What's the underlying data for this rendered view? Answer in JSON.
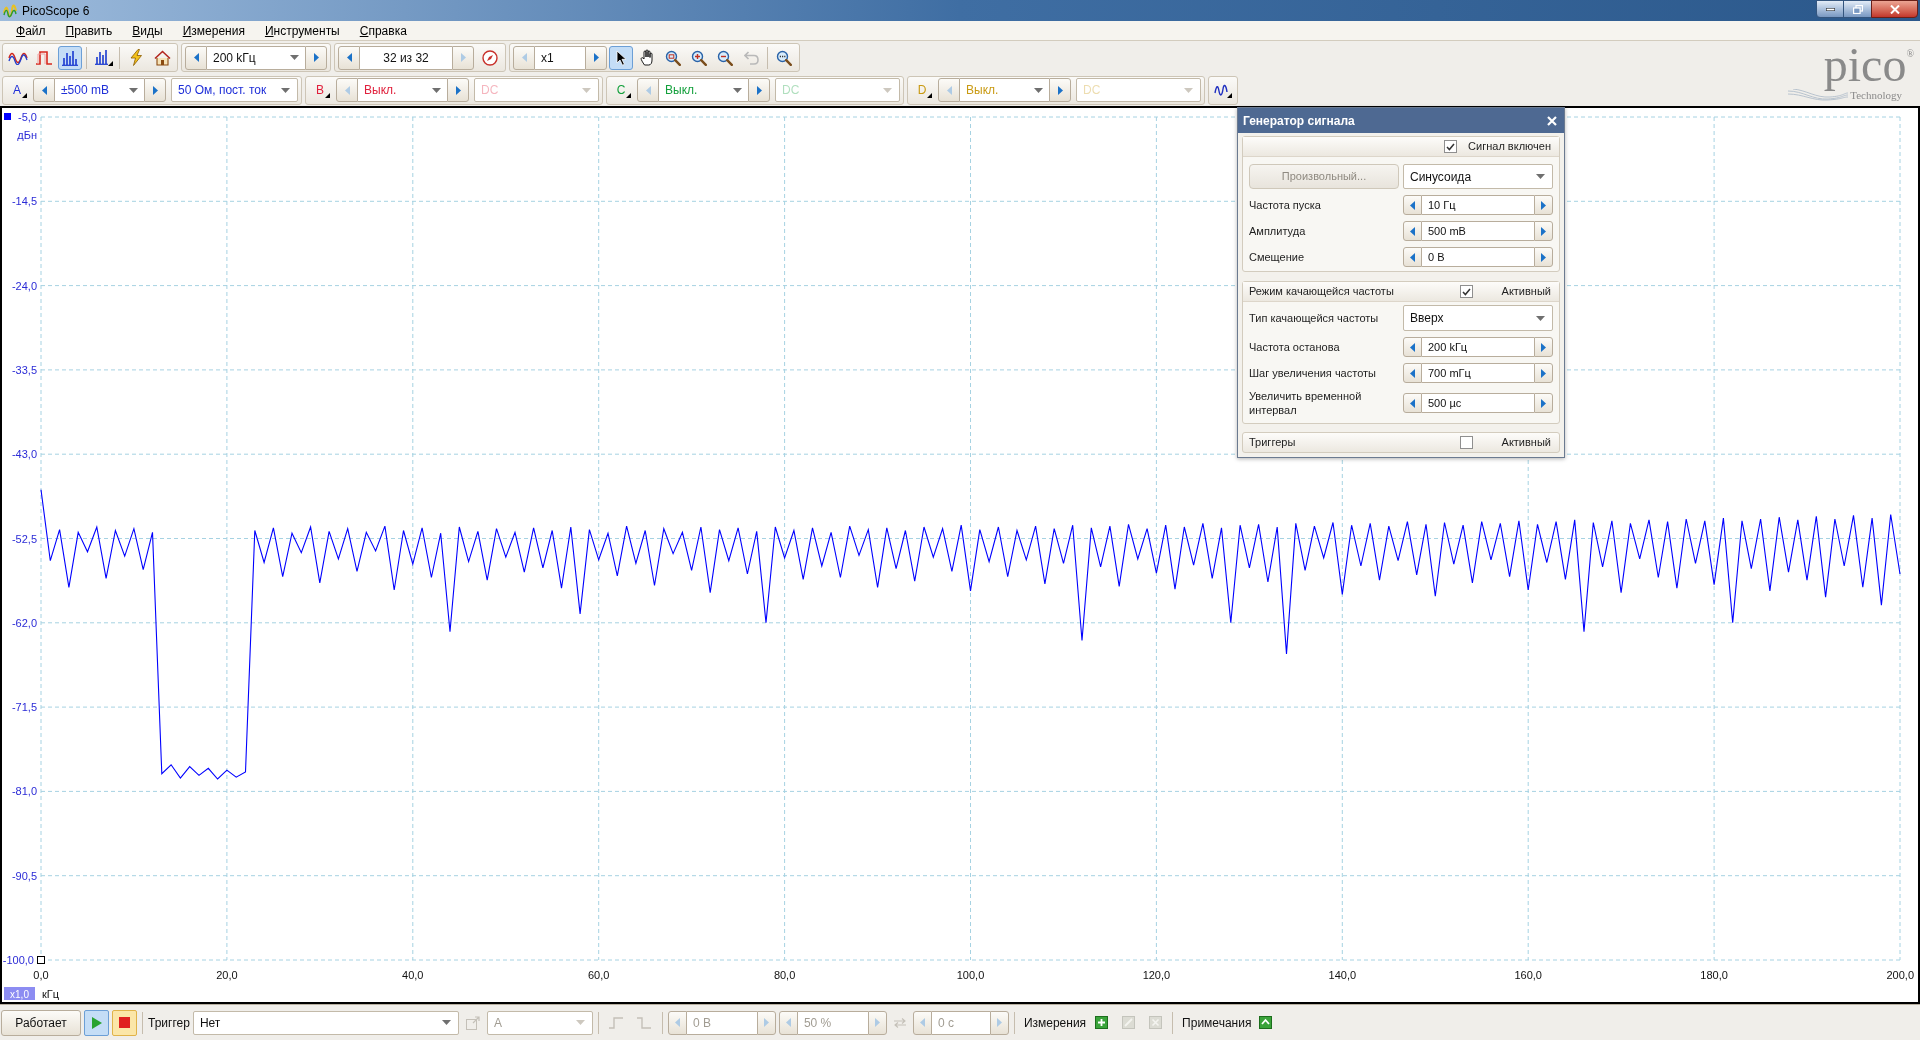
{
  "window": {
    "title": "PicoScope 6"
  },
  "menu": [
    "Файл",
    "Править",
    "Виды",
    "Измерения",
    "Инструменты",
    "Справка"
  ],
  "toolbar": {
    "modes": [
      {
        "kind": "scope",
        "selected": false
      },
      {
        "kind": "persistence",
        "selected": false
      },
      {
        "kind": "spectrum",
        "selected": true
      }
    ],
    "timebase": {
      "value": "200 kГц",
      "prev_disabled": false,
      "next_disabled": false
    },
    "buffer": {
      "value": "32 из 32",
      "prev_disabled": false,
      "next_disabled": true
    },
    "zoom": {
      "value": "x1",
      "prev_disabled": true,
      "next_disabled": false
    },
    "tools": [
      {
        "kind": "pointer",
        "selected": true
      },
      {
        "kind": "hand",
        "selected": false
      },
      {
        "kind": "zoom-area",
        "selected": false
      },
      {
        "kind": "zoom-in",
        "selected": false
      },
      {
        "kind": "zoom-out",
        "selected": false
      }
    ],
    "undo": {
      "disabled": true
    }
  },
  "channels": [
    {
      "letter": "A",
      "color": "#1f2fd8",
      "range": "±500 mВ",
      "coupling": "50 Ом, пост. ток",
      "enabled": true
    },
    {
      "letter": "B",
      "color": "#e0203c",
      "range": "Выкл.",
      "coupling": "DC",
      "enabled": false
    },
    {
      "letter": "C",
      "color": "#13a03c",
      "range": "Выкл.",
      "coupling": "DC",
      "enabled": false
    },
    {
      "letter": "D",
      "color": "#c99a12",
      "range": "Выкл.",
      "coupling": "DC",
      "enabled": false
    }
  ],
  "logo": {
    "name": "pico",
    "mark": "®",
    "tagline": "Technology"
  },
  "chart": {
    "x_zoom": "x1,0",
    "chart_data": {
      "type": "line",
      "grid": true,
      "xlabel": "кГц",
      "ylabel": "дБн",
      "xlim": [
        0,
        200
      ],
      "ylim": [
        -100,
        -5
      ],
      "xticks": [
        {
          "value": 0,
          "label": "0,0"
        },
        {
          "value": 20,
          "label": "20,0"
        },
        {
          "value": 40,
          "label": "40,0"
        },
        {
          "value": 60,
          "label": "60,0"
        },
        {
          "value": 80,
          "label": "80,0"
        },
        {
          "value": 100,
          "label": "100,0"
        },
        {
          "value": 120,
          "label": "120,0"
        },
        {
          "value": 140,
          "label": "140,0"
        },
        {
          "value": 160,
          "label": "160,0"
        },
        {
          "value": 180,
          "label": "180,0"
        },
        {
          "value": 200,
          "label": "200,0"
        }
      ],
      "yticks": [
        {
          "value": -5,
          "label": "-5,0"
        },
        {
          "value": -14.5,
          "label": "-14,5"
        },
        {
          "value": -24,
          "label": "-24,0"
        },
        {
          "value": -33.5,
          "label": "-33,5"
        },
        {
          "value": -43,
          "label": "-43,0"
        },
        {
          "value": -52.5,
          "label": "-52,5"
        },
        {
          "value": -62,
          "label": "-62,0"
        },
        {
          "value": -71.5,
          "label": "-71,5"
        },
        {
          "value": -81,
          "label": "-81,0"
        },
        {
          "value": -90.5,
          "label": "-90,5"
        },
        {
          "value": -100,
          "label": "-100,0"
        }
      ],
      "x": [
        0,
        1,
        2,
        3,
        4,
        5,
        6,
        7,
        8,
        9,
        10,
        11,
        12,
        13,
        14,
        15,
        16,
        17,
        18,
        19,
        20,
        21,
        22,
        23,
        24,
        25,
        26,
        27,
        28,
        29,
        30,
        31,
        32,
        33,
        34,
        35,
        36,
        37,
        38,
        39,
        40,
        41,
        42,
        43,
        44,
        45,
        46,
        47,
        48,
        49,
        50,
        51,
        52,
        53,
        54,
        55,
        56,
        57,
        58,
        59,
        60,
        61,
        62,
        63,
        64,
        65,
        66,
        67,
        68,
        69,
        70,
        71,
        72,
        73,
        74,
        75,
        76,
        77,
        78,
        79,
        80,
        81,
        82,
        83,
        84,
        85,
        86,
        87,
        88,
        89,
        90,
        91,
        92,
        93,
        94,
        95,
        96,
        97,
        98,
        99,
        100,
        101,
        102,
        103,
        104,
        105,
        106,
        107,
        108,
        109,
        110,
        111,
        112,
        113,
        114,
        115,
        116,
        117,
        118,
        119,
        120,
        121,
        122,
        123,
        124,
        125,
        126,
        127,
        128,
        129,
        130,
        131,
        132,
        133,
        134,
        135,
        136,
        137,
        138,
        139,
        140,
        141,
        142,
        143,
        144,
        145,
        146,
        147,
        148,
        149,
        150,
        151,
        152,
        153,
        154,
        155,
        156,
        157,
        158,
        159,
        160,
        161,
        162,
        163,
        164,
        165,
        166,
        167,
        168,
        169,
        170,
        171,
        172,
        173,
        174,
        175,
        176,
        177,
        178,
        179,
        180,
        181,
        182,
        183,
        184,
        185,
        186,
        187,
        188,
        189,
        190,
        191,
        192,
        193,
        194,
        195,
        196,
        197,
        198,
        199,
        200
      ],
      "series": [
        {
          "color": "#0000ff",
          "values": [
            -47.0,
            -55.0,
            -51.5,
            -58.0,
            -51.8,
            -54.0,
            -51.2,
            -57.0,
            -51.6,
            -54.5,
            -51.4,
            -56.0,
            -51.8,
            -79.0,
            -78.0,
            -79.5,
            -78.2,
            -79.2,
            -78.4,
            -79.6,
            -78.6,
            -79.4,
            -78.8,
            -51.6,
            -55.2,
            -51.3,
            -56.8,
            -51.9,
            -54.1,
            -51.2,
            -57.5,
            -51.7,
            -54.8,
            -51.4,
            -56.2,
            -51.8,
            -53.9,
            -51.1,
            -58.3,
            -51.6,
            -55.4,
            -51.3,
            -56.9,
            -51.9,
            -63.0,
            -51.2,
            -55.1,
            -51.7,
            -57.2,
            -51.4,
            -54.6,
            -51.8,
            -56.3,
            -51.3,
            -55.8,
            -51.6,
            -58.1,
            -51.2,
            -61.0,
            -51.5,
            -54.9,
            -51.9,
            -56.7,
            -51.1,
            -55.3,
            -51.6,
            -57.8,
            -51.4,
            -54.2,
            -51.8,
            -56.1,
            -51.2,
            -58.6,
            -51.5,
            -55.0,
            -51.3,
            -56.5,
            -51.7,
            -62.0,
            -51.2,
            -54.7,
            -51.6,
            -57.1,
            -51.3,
            -55.6,
            -51.8,
            -56.9,
            -51.1,
            -54.4,
            -51.5,
            -58.0,
            -51.3,
            -55.9,
            -51.6,
            -57.3,
            -51.2,
            -54.6,
            -51.4,
            -56.2,
            -51.0,
            -58.4,
            -51.5,
            -55.1,
            -51.2,
            -56.8,
            -51.6,
            -54.9,
            -51.1,
            -57.6,
            -51.4,
            -55.3,
            -51.0,
            -64.0,
            -51.3,
            -55.7,
            -51.1,
            -57.9,
            -50.9,
            -54.8,
            -51.4,
            -56.4,
            -51.0,
            -58.2,
            -51.2,
            -55.5,
            -50.8,
            -57.0,
            -51.3,
            -62.0,
            -51.0,
            -55.8,
            -50.9,
            -57.4,
            -51.2,
            -65.5,
            -50.8,
            -56.1,
            -51.1,
            -54.7,
            -50.7,
            -58.8,
            -51.0,
            -55.6,
            -50.8,
            -57.2,
            -51.1,
            -55.0,
            -50.6,
            -56.6,
            -50.9,
            -59.0,
            -50.7,
            -55.4,
            -51.0,
            -57.5,
            -50.6,
            -54.9,
            -50.8,
            -56.8,
            -50.5,
            -58.3,
            -50.9,
            -55.2,
            -50.6,
            -57.1,
            -50.4,
            -63.0,
            -50.7,
            -55.7,
            -50.5,
            -58.6,
            -50.8,
            -54.8,
            -50.4,
            -56.9,
            -50.6,
            -58.1,
            -50.3,
            -55.3,
            -50.5,
            -57.7,
            -50.2,
            -62.0,
            -50.5,
            -55.9,
            -50.3,
            -58.4,
            -50.1,
            -56.3,
            -50.4,
            -57.2,
            -50.0,
            -59.1,
            -50.3,
            -55.6,
            -49.9,
            -58.0,
            -50.2,
            -60.0,
            -49.8,
            -56.5
          ]
        }
      ]
    }
  },
  "signal_generator": {
    "title": "Генератор сигнала",
    "output": {
      "label": "Сигнал включен",
      "checked": true
    },
    "arbitrary_button": {
      "label": "Произвольный...",
      "disabled": true
    },
    "waveform": "Синусоида",
    "fields": [
      {
        "label": "Частота пуска",
        "value": "10 Гц"
      },
      {
        "label": "Амплитуда",
        "value": "500 mВ"
      },
      {
        "label": "Смещение",
        "value": "0 В"
      }
    ],
    "sweep": {
      "label": "Режим качающейся частоты",
      "checked": true,
      "status": "Активный",
      "rows": [
        {
          "kind": "dropdown",
          "label": "Тип качающейся частоты",
          "value": "Вверх"
        },
        {
          "kind": "spinner",
          "label": "Частота останова",
          "value": "200 kГц"
        },
        {
          "kind": "spinner",
          "label": "Шаг увеличения частоты",
          "value": "700 mГц"
        },
        {
          "kind": "spinner",
          "label": "Увеличить временной интервал",
          "value": "500 µс"
        }
      ]
    },
    "triggers": {
      "label": "Триггеры",
      "checked": false,
      "status": "Активный"
    }
  },
  "status_bar": {
    "run": {
      "label": "Работает"
    },
    "run_buttons": [
      {
        "kind": "play",
        "selected": true
      },
      {
        "kind": "stop",
        "selected": false
      }
    ],
    "trigger": {
      "label": "Триггер",
      "mode": "Нет",
      "properties_disabled": true
    },
    "source": {
      "value": "A",
      "disabled": true
    },
    "edges": [
      {
        "kind": "rising",
        "disabled": true
      },
      {
        "kind": "falling",
        "disabled": true
      }
    ],
    "threshold": {
      "value": "0 В",
      "disabled": true
    },
    "pretrigger": {
      "value": "50 %",
      "disabled": true
    },
    "delay": {
      "value": "0 с",
      "disabled": true
    },
    "measurements": {
      "label": "Измерения",
      "buttons": [
        {
          "kind": "add",
          "disabled": false
        },
        {
          "kind": "edit",
          "disabled": true
        },
        {
          "kind": "delete",
          "disabled": true
        }
      ]
    },
    "notes": {
      "label": "Примечания"
    }
  }
}
